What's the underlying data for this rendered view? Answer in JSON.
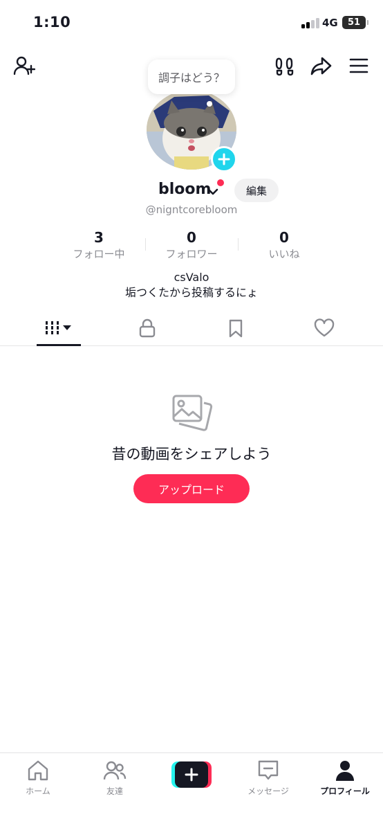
{
  "status_bar": {
    "time": "1:10",
    "network": "4G",
    "battery": "51"
  },
  "header": {
    "icons": [
      "add-friend-icon",
      "footprints-icon",
      "share-icon",
      "menu-icon"
    ]
  },
  "bubble": {
    "text": "調子はどう？"
  },
  "profile": {
    "username": "bloom",
    "edit_label": "編集",
    "handle": "@nigntcorebloom",
    "bio_line1": "csValo",
    "bio_line2": "垢つくたから投稿するにょ"
  },
  "stats": [
    {
      "value": "3",
      "label": "フォロー中"
    },
    {
      "value": "0",
      "label": "フォロワー"
    },
    {
      "value": "0",
      "label": "いいね"
    }
  ],
  "tabs": [
    "videos-grid-icon",
    "lock-icon",
    "bookmark-icon",
    "heart-icon"
  ],
  "empty_state": {
    "title": "昔の動画をシェアしよう",
    "button_label": "アップロード"
  },
  "bottom_nav": [
    {
      "label": "ホーム",
      "icon": "home-icon"
    },
    {
      "label": "友達",
      "icon": "friends-icon"
    },
    {
      "label": "",
      "icon": "plus-icon"
    },
    {
      "label": "メッセージ",
      "icon": "message-icon"
    },
    {
      "label": "プロフィール",
      "icon": "profile-icon",
      "active": true
    }
  ],
  "colors": {
    "accent": "#fe2c55",
    "cyan": "#20d5ec",
    "text": "#161823",
    "muted": "#8a8b91"
  }
}
